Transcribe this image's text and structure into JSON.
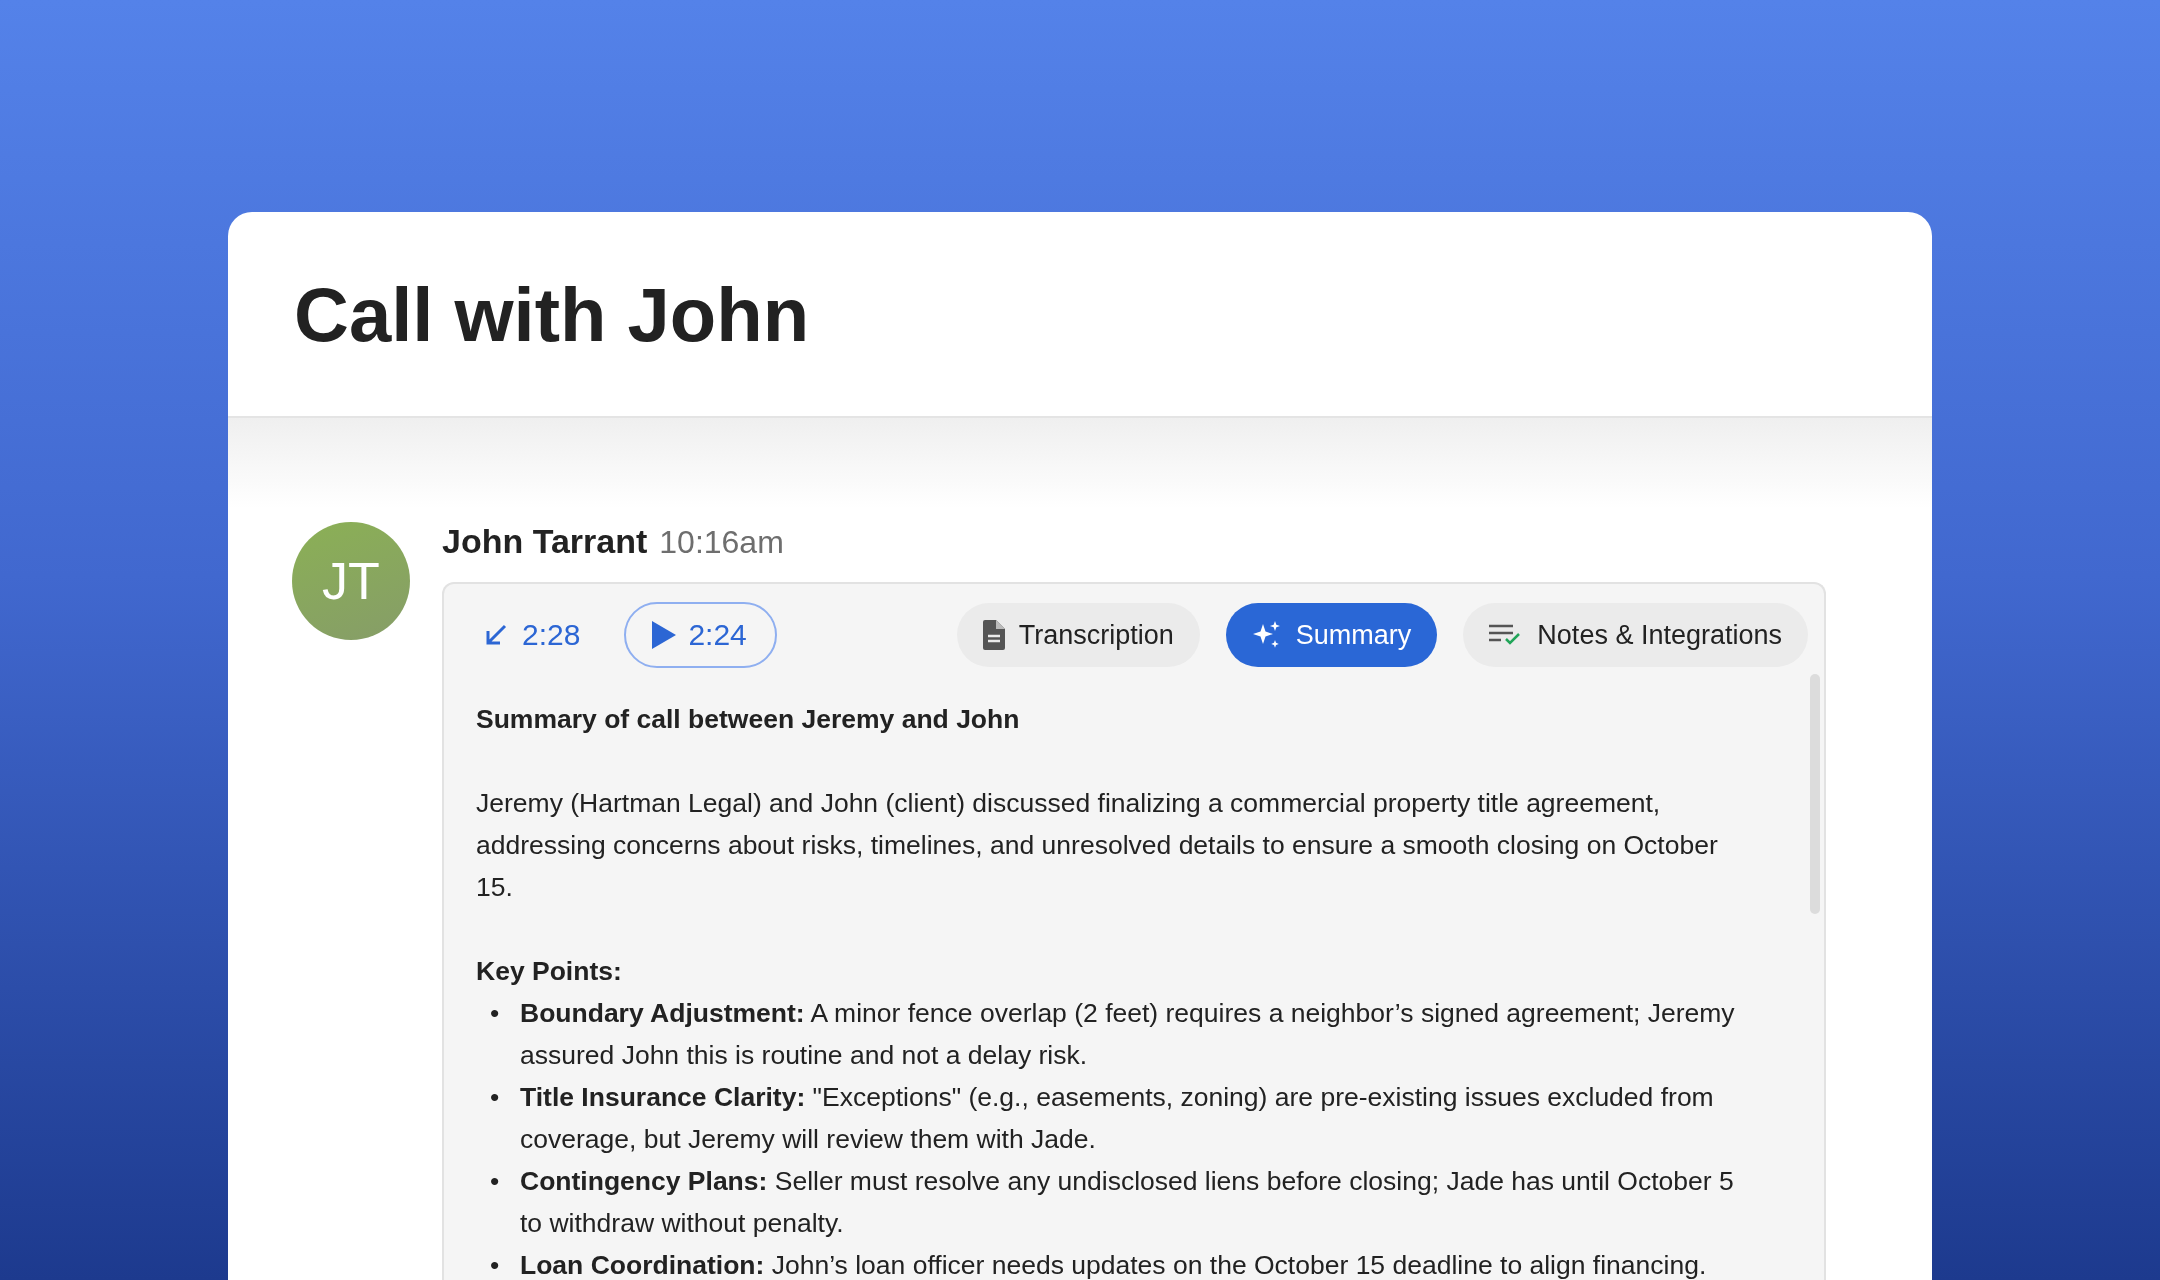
{
  "title": "Call with John",
  "message": {
    "avatar_initials": "JT",
    "author": "John Tarrant",
    "time": "10:16am",
    "call_duration": "2:28",
    "playback": "2:24",
    "tabs": [
      {
        "label": "Transcription",
        "kind": "transcript",
        "selected": false
      },
      {
        "label": "Summary",
        "kind": "summary",
        "selected": true
      },
      {
        "label": "Notes & Integrations",
        "kind": "notes",
        "selected": false
      }
    ],
    "summary": {
      "heading": "Summary of call between Jeremy and John",
      "paragraph": "Jeremy (Hartman Legal) and John (client) discussed finalizing a commercial property title agreement, addressing concerns about risks, timelines, and unresolved details to ensure a smooth closing on October 15.",
      "key_points_label": "Key Points:",
      "points": [
        {
          "bullet": "•",
          "title": "Boundary Adjustment:",
          "text": "A minor fence overlap (2 feet) requires a neighbor’s signed agreement; Jeremy assured John this is routine and not a delay risk."
        },
        {
          "bullet": "•",
          "title": "Title Insurance Clarity:",
          "text": "\"Exceptions\" (e.g., easements, zoning) are pre-existing issues excluded from coverage, but Jeremy will review them with Jade."
        },
        {
          "bullet": "•",
          "title": "Contingency Plans:",
          "text": "Seller must resolve any undisclosed liens before closing; Jade has until October 5 to withdraw without penalty."
        },
        {
          "bullet": "•",
          "title": "Loan Coordination:",
          "text": "John’s loan officer needs updates on the October 15 deadline to align financing."
        }
      ]
    }
  }
}
